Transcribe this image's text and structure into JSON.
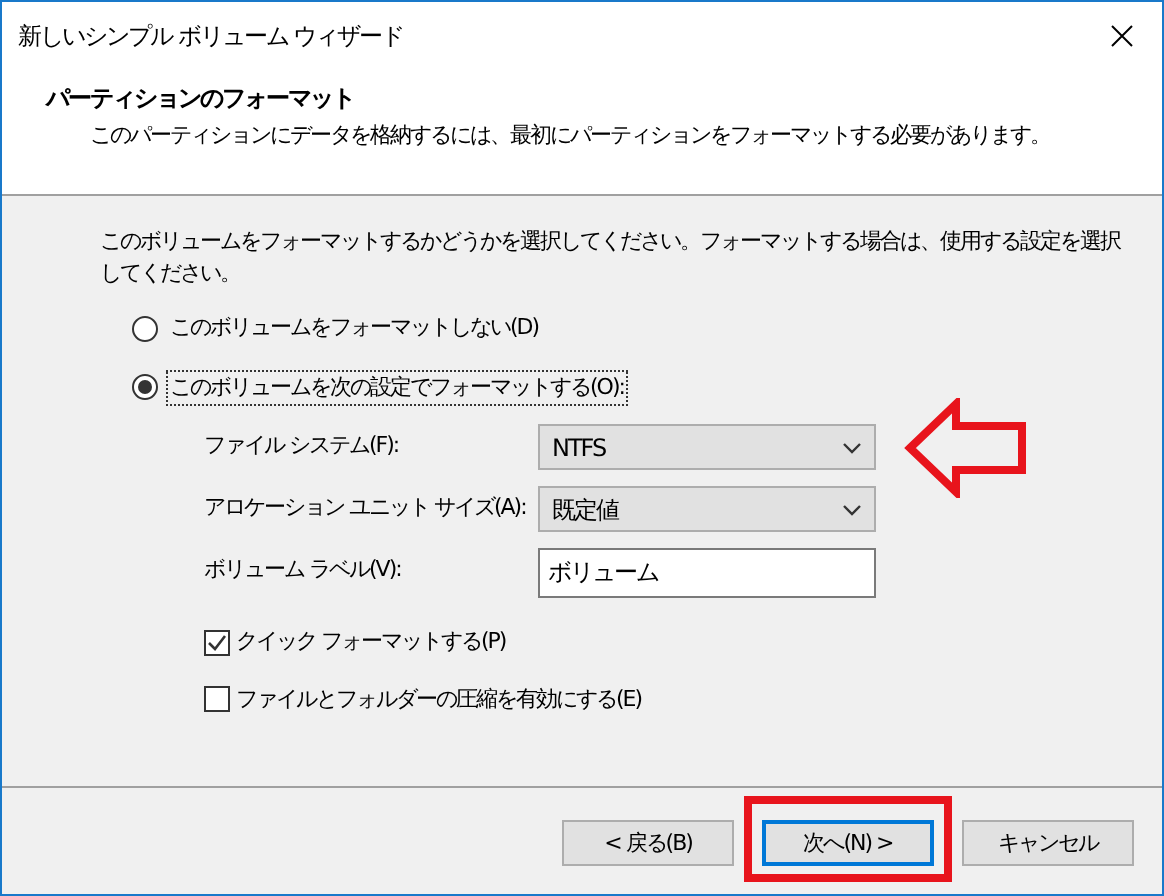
{
  "window": {
    "title": "新しいシンプル ボリューム ウィザード"
  },
  "header": {
    "title": "パーティションのフォーマット",
    "subtitle": "このパーティションにデータを格納するには、最初にパーティションをフォーマットする必要があります。"
  },
  "instruction": "このボリュームをフォーマットするかどうかを選択してください。フォーマットする場合は、使用する設定を選択してください。",
  "format_options": [
    {
      "label": "このボリュームをフォーマットしない(D)",
      "selected": false
    },
    {
      "label": "このボリュームを次の設定でフォーマットする(O):",
      "selected": true
    }
  ],
  "settings": [
    {
      "kind": "dropdown",
      "label": "ファイル システム(F):",
      "value": "NTFS",
      "highlighted": true
    },
    {
      "kind": "dropdown",
      "label": "アロケーション ユニット サイズ(A):",
      "value": "既定値",
      "highlighted": false
    },
    {
      "kind": "text",
      "label": "ボリューム ラベル(V):",
      "value": "ボリューム",
      "highlighted": false
    }
  ],
  "checkboxes": [
    {
      "label": "クイック フォーマットする(P)",
      "checked": true
    },
    {
      "label": "ファイルとフォルダーの圧縮を有効にする(E)",
      "checked": false
    }
  ],
  "buttons": [
    {
      "label": "< 戻る(B)",
      "default": false,
      "highlighted": false
    },
    {
      "label": "次へ(N) >",
      "default": true,
      "highlighted": true
    },
    {
      "label": "キャンセル",
      "default": false,
      "highlighted": false
    }
  ]
}
